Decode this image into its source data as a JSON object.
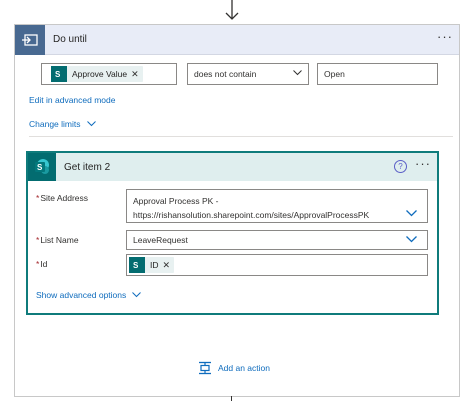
{
  "do_until": {
    "title": "Do until",
    "menu_icon": "ellipsis-icon",
    "condition": {
      "token_label": "Approve Value",
      "operator": "does not contain",
      "value": "Open"
    },
    "edit_advanced_label": "Edit in advanced mode",
    "change_limits_label": "Change limits"
  },
  "get_item": {
    "title": "Get item 2",
    "help_label": "?",
    "fields": {
      "site_address_label": "Site Address",
      "site_address_line1": "Approval Process PK -",
      "site_address_line2": "https://rishansolution.sharepoint.com/sites/ApprovalProcessPK",
      "list_name_label": "List Name",
      "list_name_value": "LeaveRequest",
      "id_label": "Id",
      "id_token": "ID"
    },
    "show_advanced_label": "Show advanced options"
  },
  "add_action_label": "Add an action",
  "colors": {
    "loop_accent": "#486991",
    "sharepoint": "#036c70",
    "link": "#0f6cbd",
    "required": "#a4262c"
  }
}
